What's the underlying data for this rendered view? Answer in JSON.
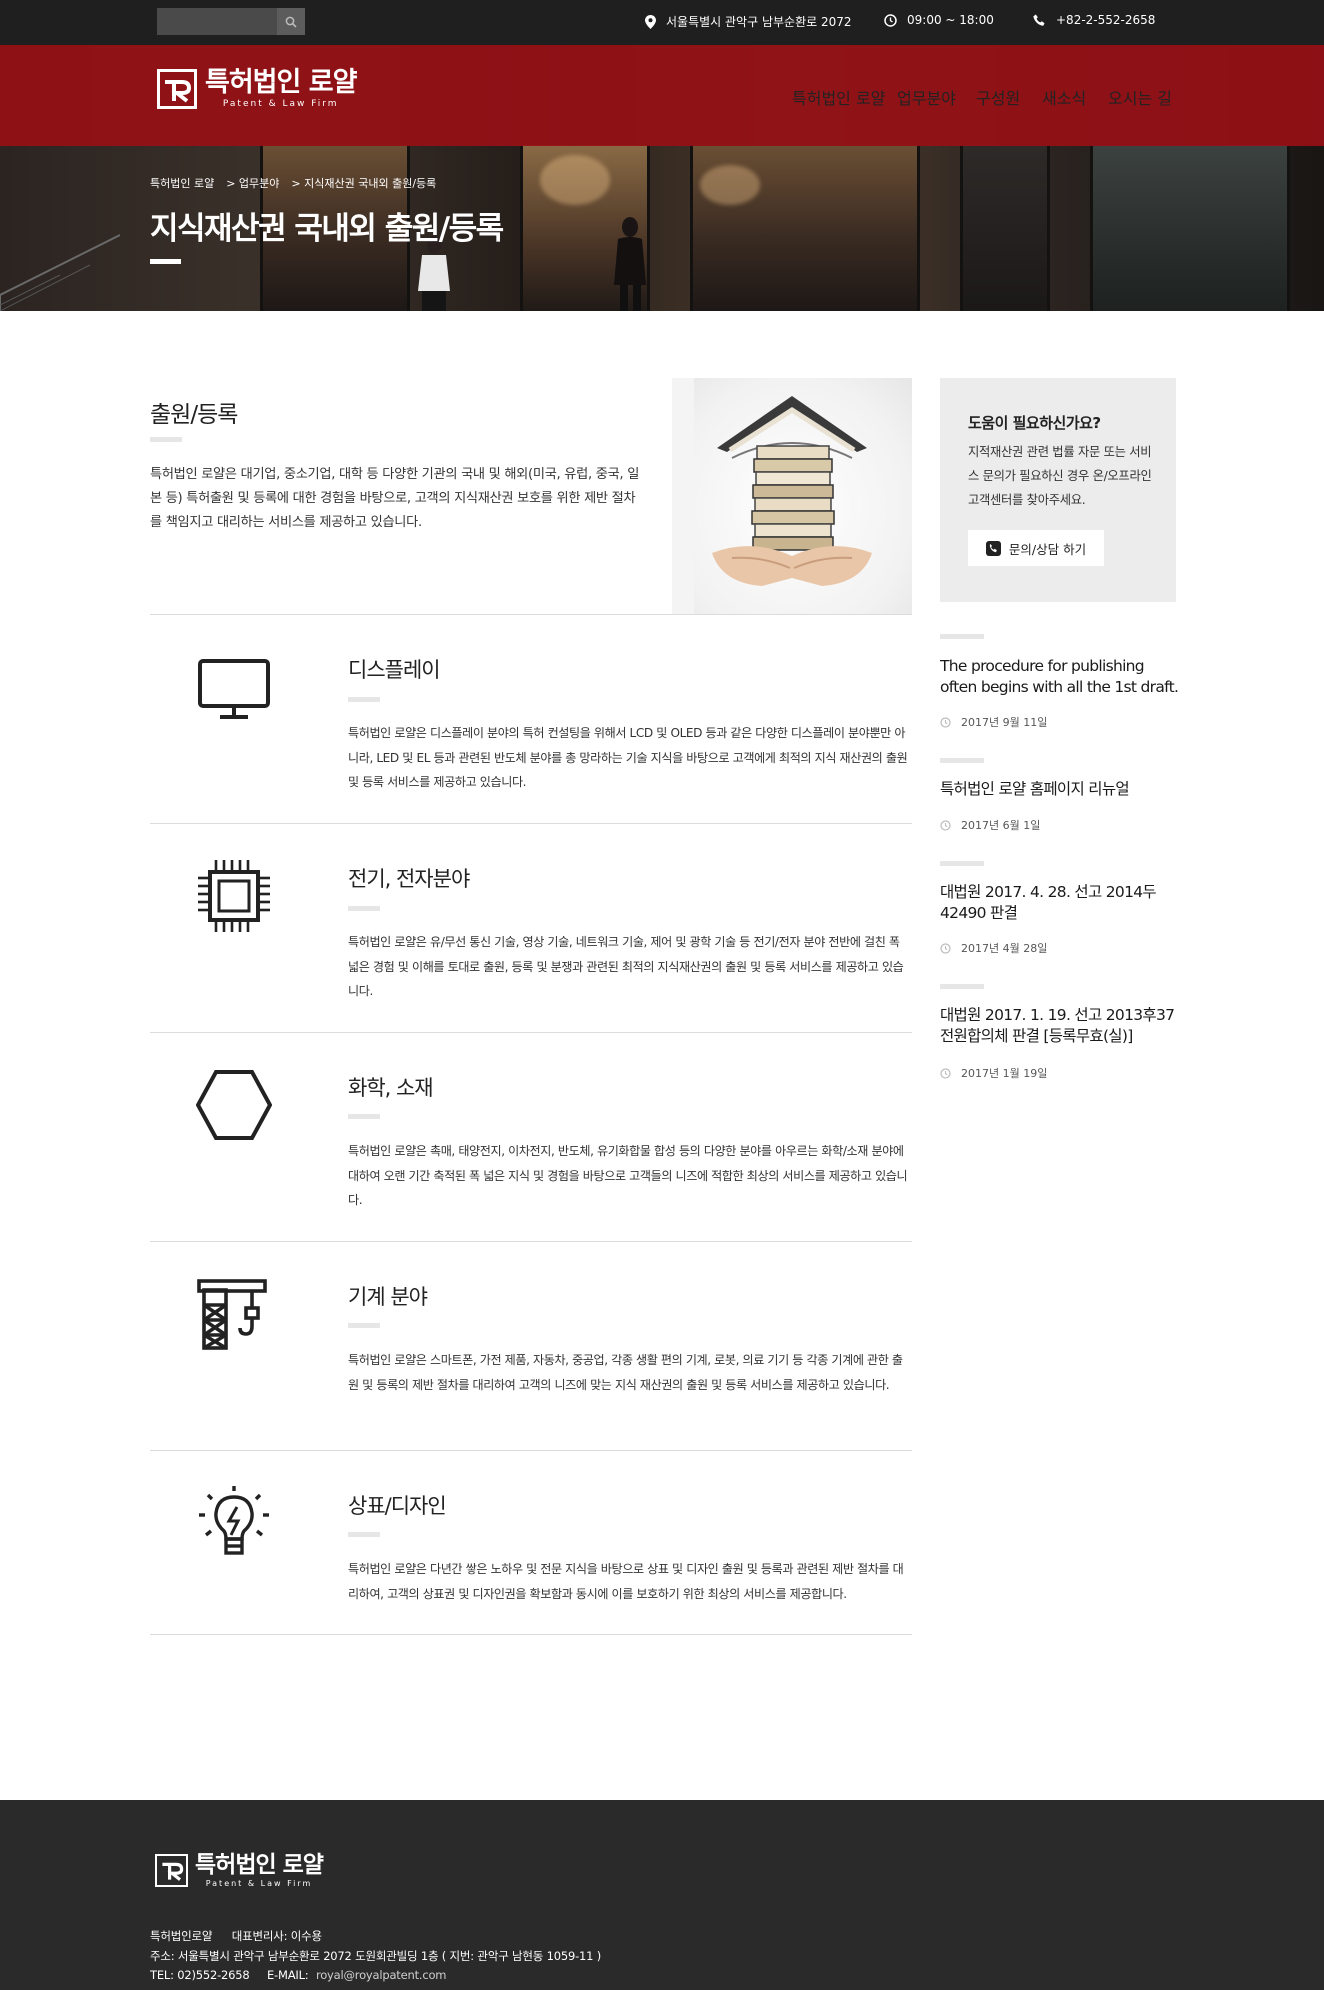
{
  "topbar": {
    "search_placeholder": "",
    "address": "서울특별시 관악구 남부순환로 2072",
    "hours": "09:00 ~ 18:00",
    "phone": "+82-2-552-2658"
  },
  "brand": {
    "name_ko": "특허법인 로얄",
    "name_en": "Patent & Law Firm"
  },
  "nav": {
    "items": [
      {
        "label": "특허법인 로얄"
      },
      {
        "label": "업무분야"
      },
      {
        "label": "구성원"
      },
      {
        "label": "새소식"
      },
      {
        "label": "오시는 길"
      }
    ]
  },
  "breadcrumb": [
    "특허법인 로얄",
    "> 업무분야",
    "> 지식재산권 국내외 출원/등록"
  ],
  "hero_title": "지식재산권 국내외 출원/등록",
  "intro": {
    "title": "출원/등록",
    "text": "특허법인 로얄은 대기업, 중소기업, 대학 등 다양한 기관의 국내 및 해외(미국, 유럽, 중국, 일본 등) 특허출원 및 등록에 대한 경험을 바탕으로, 고객의 지식재산권 보호를 위한 제반 절차를 책임지고 대리하는 서비스를 제공하고 있습니다."
  },
  "sections": [
    {
      "icon": "monitor-icon",
      "title": "디스플레이",
      "text": "특허법인 로얄은 디스플레이 분야의 특허 컨설팅을 위해서 LCD 및 OLED 등과 같은 다양한 디스플레이 분야뿐만 아니라, LED 및 EL 등과 관련된 반도체 분야를 총 망라하는 기술 지식을 바탕으로 고객에게 최적의 지식 재산권의 출원 및 등록 서비스를 제공하고 있습니다."
    },
    {
      "icon": "chip-icon",
      "title": "전기, 전자분야",
      "text": "특허법인 로얄은 유/무선 통신 기술, 영상 기술, 네트워크 기술, 제어 및 광학 기술 등 전기/전자 분야 전반에 걸친 폭 넓은 경험 및 이해를 토대로 출원, 등록 및 분쟁과 관련된 최적의 지식재산권의 출원 및 등록 서비스를 제공하고 있습니다."
    },
    {
      "icon": "hexagon-icon",
      "title": "화학, 소재",
      "text": "특허법인 로얄은 촉매, 태양전지, 이차전지, 반도체, 유기화합물 합성 등의 다양한 분야를 아우르는 화학/소재 분야에 대하여 오랜 기간 축적된 폭 넓은 지식 및 경험을 바탕으로 고객들의 니즈에 적합한 최상의 서비스를 제공하고 있습니다."
    },
    {
      "icon": "crane-icon",
      "title": "기계 분야",
      "text": "특허법인 로얄은 스마트폰, 가전 제품, 자동차, 중공업, 각종 생활 편의 기계, 로봇, 의료 기기 등 각종 기계에 관한 출원 및 등록의 제반 절차를 대리하여 고객의 니즈에 맞는 지식 재산권의 출원 및 등록 서비스를 제공하고 있습니다."
    },
    {
      "icon": "lightbulb-icon",
      "title": "상표/디자인",
      "text": "특허법인 로얄은 다년간 쌓은 노하우 및 전문 지식을 바탕으로 상표 및 디자인 출원 및 등록과 관련된 제반 절차를 대리하여, 고객의 상표권 및 디자인권을 확보함과 동시에 이를 보호하기 위한 최상의 서비스를 제공합니다."
    }
  ],
  "help": {
    "title": "도움이 필요하신가요?",
    "text": "지적재산권 관련 법률 자문 또는 서비스 문의가 필요하신 경우 온/오프라인 고객센터를 찾아주세요.",
    "button": "문의/상담 하기"
  },
  "news": [
    {
      "title": "The procedure for publishing often begins with all the 1st draft.",
      "date": "2017년 9월 11일"
    },
    {
      "title": "특허법인 로얄 홈페이지 리뉴얼",
      "date": "2017년 6월 1일"
    },
    {
      "title": "대법원 2017. 4. 28. 선고 2014두42490 판결",
      "date": "2017년 4월 28일"
    },
    {
      "title": "대법원 2017. 1. 19. 선고 2013후37 전원합의체 판결 [등록무효(실)]",
      "date": "2017년 1월 19일"
    }
  ],
  "footer": {
    "company": "특허법인로얄",
    "ceo_label": "대표변리사: 이수용",
    "address": "주소: 서울특별시 관악구 남부순환로 2072 도원회관빌딩 1층 ( 지번: 관악구 남현동 1059-11 )",
    "tel": "TEL: 02)552-2658",
    "email_label": "E-MAIL:",
    "email": "royal@royalpatent.com"
  },
  "colors": {
    "brand_red": "#96101a",
    "dark": "#1f1f1f",
    "footer": "#2a2a2a"
  }
}
